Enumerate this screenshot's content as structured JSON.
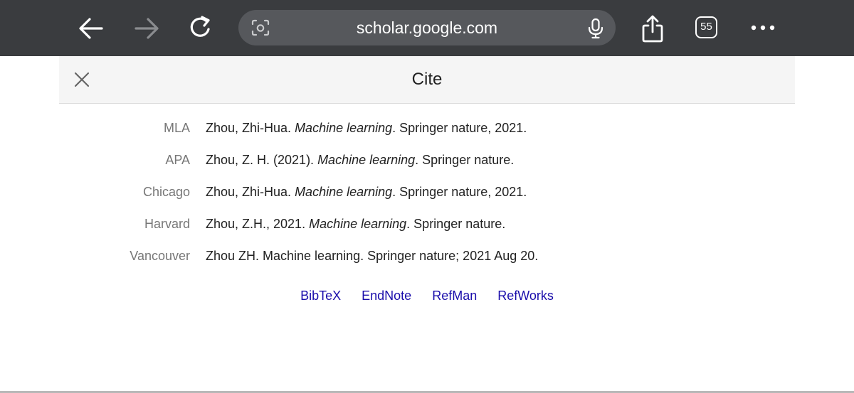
{
  "browser": {
    "url": "scholar.google.com",
    "tab_count": "55",
    "icons": [
      "back-arrow-icon",
      "forward-arrow-icon",
      "reload-icon",
      "lens-camera-icon",
      "microphone-icon",
      "share-icon",
      "tabs-icon",
      "more-icon"
    ]
  },
  "dialog": {
    "title": "Cite",
    "close_icon": "close-icon"
  },
  "citations": [
    {
      "style": "MLA",
      "pre": "Zhou, Zhi-Hua. ",
      "italic": "Machine learning",
      "post": ". Springer nature, 2021."
    },
    {
      "style": "APA",
      "pre": "Zhou, Z. H. (2021). ",
      "italic": "Machine learning",
      "post": ". Springer nature."
    },
    {
      "style": "Chicago",
      "pre": "Zhou, Zhi-Hua. ",
      "italic": "Machine learning",
      "post": ". Springer nature, 2021."
    },
    {
      "style": "Harvard",
      "pre": "Zhou, Z.H., 2021. ",
      "italic": "Machine learning",
      "post": ". Springer nature."
    },
    {
      "style": "Vancouver",
      "pre": "Zhou ZH. Machine learning. Springer nature; 2021 Aug 20.",
      "italic": "",
      "post": ""
    }
  ],
  "export_links": [
    "BibTeX",
    "EndNote",
    "RefMan",
    "RefWorks"
  ],
  "colors": {
    "toolbar": "#3a3c3f",
    "urlbar": "#56585c",
    "header_bg": "#f5f5f5",
    "link": "#1a0dab",
    "label": "#777777"
  }
}
